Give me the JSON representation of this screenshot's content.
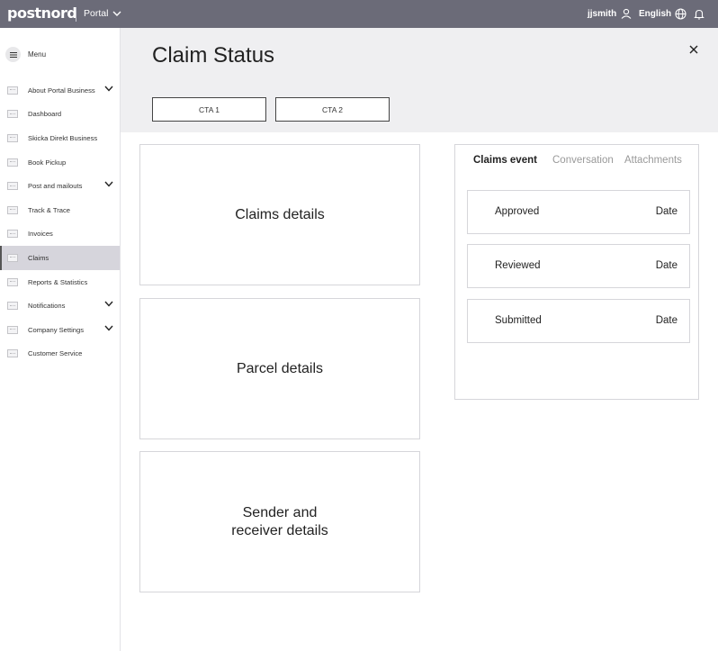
{
  "topbar": {
    "logo_text": "postnord",
    "portal_label": "Portal",
    "username": "jjsmith",
    "language": "English"
  },
  "sidebar": {
    "menu_label": "Menu",
    "items": [
      {
        "label": "About Portal Business",
        "expandable": true
      },
      {
        "label": "Dashboard",
        "expandable": false
      },
      {
        "label": "Skicka Direkt Business",
        "expandable": false
      },
      {
        "label": "Book Pickup",
        "expandable": false
      },
      {
        "label": "Post and mailouts",
        "expandable": true
      },
      {
        "label": "Track & Trace",
        "expandable": false
      },
      {
        "label": "Invoices",
        "expandable": false
      },
      {
        "label": "Claims",
        "expandable": false,
        "active": true
      },
      {
        "label": "Reports & Statistics",
        "expandable": false
      },
      {
        "label": "Notifications",
        "expandable": true
      },
      {
        "label": "Company Settings",
        "expandable": true
      },
      {
        "label": "Customer Service",
        "expandable": false
      }
    ]
  },
  "header": {
    "title": "Claim Status",
    "cta1": "CTA 1",
    "cta2": "CTA 2"
  },
  "cards": {
    "claims_details": "Claims details",
    "parcel_details": "Parcel details",
    "sender_receiver_line1": "Sender and",
    "sender_receiver_line2": "receiver details"
  },
  "events_panel": {
    "tabs": [
      "Claims event",
      "Conversation",
      "Attachments"
    ],
    "events": [
      {
        "label": "Approved",
        "date": "Date"
      },
      {
        "label": "Reviewed",
        "date": "Date"
      },
      {
        "label": "Submitted",
        "date": "Date"
      }
    ]
  },
  "colors": {
    "topbar_bg": "#6b6b78",
    "header_bg": "#efeff1",
    "active_nav_bg": "#d6d5dc"
  }
}
